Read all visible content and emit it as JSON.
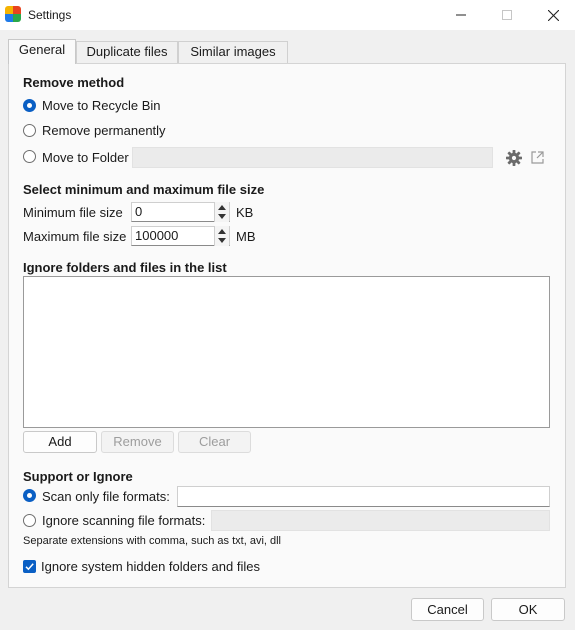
{
  "window": {
    "title": "Settings",
    "app_icon": "app-logo-icon"
  },
  "tabs": [
    {
      "label": "General",
      "active": true
    },
    {
      "label": "Duplicate files",
      "active": false
    },
    {
      "label": "Similar images",
      "active": false
    }
  ],
  "remove_method": {
    "heading": "Remove method",
    "options": [
      {
        "label": "Move to Recycle Bin",
        "selected": true
      },
      {
        "label": "Remove permanently",
        "selected": false
      },
      {
        "label": "Move to Folder",
        "selected": false
      }
    ],
    "folder_value": "",
    "settings_icon": "gear-icon",
    "open_icon": "open-external-icon"
  },
  "file_size": {
    "heading": "Select minimum and maximum file size",
    "min_label": "Minimum file size",
    "min_value": "0",
    "min_unit": "KB",
    "max_label": "Maximum file size",
    "max_value": "100000",
    "max_unit": "MB"
  },
  "ignore_list": {
    "heading": "Ignore folders and files in the list",
    "items": [],
    "add_label": "Add",
    "remove_label": "Remove",
    "clear_label": "Clear"
  },
  "support": {
    "heading": "Support or Ignore",
    "scan_label": "Scan only file formats:",
    "scan_value": "",
    "ignore_label": "Ignore scanning file formats:",
    "ignore_value": "",
    "hint": "Separate extensions with comma, such as txt, avi, dll",
    "hidden_label": "Ignore system hidden folders and files",
    "hidden_checked": true
  },
  "footer": {
    "cancel_label": "Cancel",
    "ok_label": "OK"
  },
  "colors": {
    "accent": "#0a5fc4"
  }
}
